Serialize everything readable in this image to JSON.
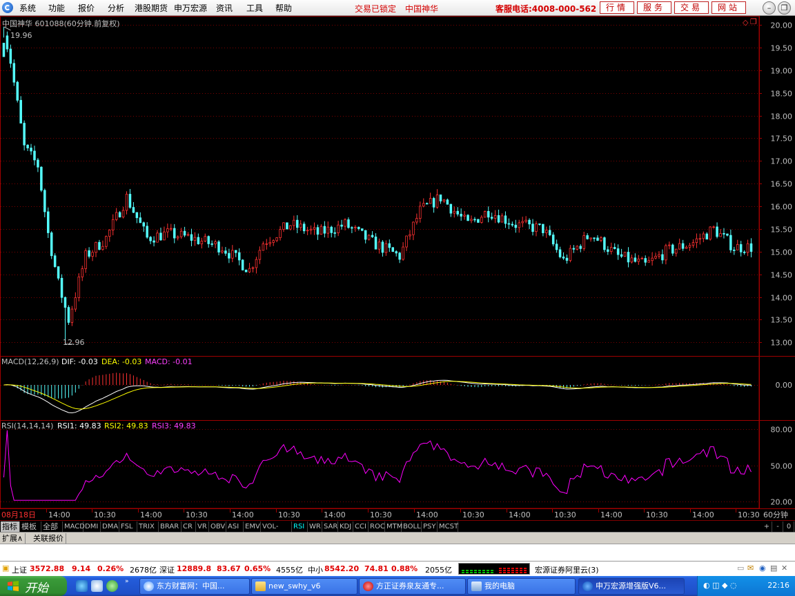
{
  "menu": {
    "items": [
      "系统",
      "功能",
      "报价",
      "分析",
      "港股期货",
      "申万宏源",
      "资讯",
      "工具",
      "帮助"
    ],
    "lock_status": "交易已锁定",
    "current_stock": "中国神华",
    "hotline": "客服电话:4008-000-562",
    "buttons": [
      "行情",
      "服务",
      "交易",
      "网站"
    ]
  },
  "chart": {
    "header": "中国神华 601088(60分钟.前复权)",
    "high_label": "19.96",
    "low_label": "12.96",
    "macd_header": {
      "name": "MACD(12,26,9)",
      "dif": "DIF: -0.03",
      "dea": "DEA: -0.03",
      "macd": "MACD: -0.01"
    },
    "rsi_header": {
      "name": "RSI(14,14,14)",
      "rsi1": "RSI1: 49.83",
      "rsi2": "RSI2: 49.83",
      "rsi3": "RSI3: 49.83"
    },
    "period": "60分钟",
    "date_label": "08月18日"
  },
  "chart_data": [
    {
      "type": "candlestick",
      "title": "中国神华 601088(60分钟.前复权)",
      "ylim": [
        12.7,
        20.2
      ],
      "y_ticks": [
        "20.00",
        "19.50",
        "19.00",
        "18.50",
        "18.00",
        "17.50",
        "17.00",
        "16.50",
        "16.00",
        "15.50",
        "15.00",
        "14.50",
        "14.00",
        "13.50",
        "13.00"
      ],
      "x_ticks": [
        "08月18日",
        "14:00",
        "10:30",
        "14:00",
        "10:30",
        "14:00",
        "10:30",
        "14:00",
        "10:30",
        "14:00",
        "10:30",
        "14:00",
        "10:30",
        "14:00",
        "10:30",
        "14:00",
        "10:30"
      ],
      "high": 19.96,
      "low": 12.96,
      "colors": {
        "up": "#ff3232",
        "down": "#54fcfc"
      }
    },
    {
      "type": "bar",
      "title": "MACD(12,26,9)",
      "y_ticks": [
        "0.00"
      ],
      "series": [
        {
          "name": "DIF",
          "value": -0.03,
          "color": "#ffffff"
        },
        {
          "name": "DEA",
          "value": -0.03,
          "color": "#ffff00"
        },
        {
          "name": "MACD",
          "value": -0.01,
          "color": "#ff00ff"
        }
      ]
    },
    {
      "type": "line",
      "title": "RSI(14,14,14)",
      "ylim": [
        20,
        80
      ],
      "y_ticks": [
        "80.00",
        "50.00",
        "20.00"
      ],
      "series": [
        {
          "name": "RSI1",
          "value": 49.83,
          "color": "#ffffff"
        },
        {
          "name": "RSI2",
          "value": 49.83,
          "color": "#ffff00"
        },
        {
          "name": "RSI3",
          "value": 49.83,
          "color": "#ff00ff"
        }
      ]
    }
  ],
  "indicator_tabs": [
    "指标",
    "模板",
    "全部",
    "MACD",
    "DMI",
    "DMA",
    "FSL",
    "TRIX",
    "BRAR",
    "CR",
    "VR",
    "OBV",
    "ASI",
    "EMV",
    "VOL-TDX",
    "RSI",
    "WR",
    "SAR",
    "KDJ",
    "CCI",
    "ROC",
    "MTM",
    "BOLL",
    "PSY",
    "MCST"
  ],
  "active_tab": "RSI",
  "expand_tabs": [
    "扩展∧",
    "关联报价"
  ],
  "status": {
    "sh_label": "上证",
    "sh_index": "3572.88",
    "sh_change": "9.14",
    "sh_pct": "0.26%",
    "sh_amount": "2678亿",
    "sz_label": "深证",
    "sz_index": "12889.8",
    "sz_change": "83.67",
    "sz_pct": "0.65%",
    "sz_amount": "4555亿",
    "zx_label": "中小",
    "zx_index": "8542.20",
    "zx_change": "74.81",
    "zx_pct": "0.88%",
    "zx_amount": "2055亿",
    "server": "宏源证券阿里云(3)"
  },
  "taskbar": {
    "start": "开始",
    "tasks": [
      "东方财富网：中国...",
      "new_swhy_v6",
      "方正证券泉友通专...",
      "我的电脑",
      "申万宏源增强版V6..."
    ],
    "clock": "22:16"
  }
}
